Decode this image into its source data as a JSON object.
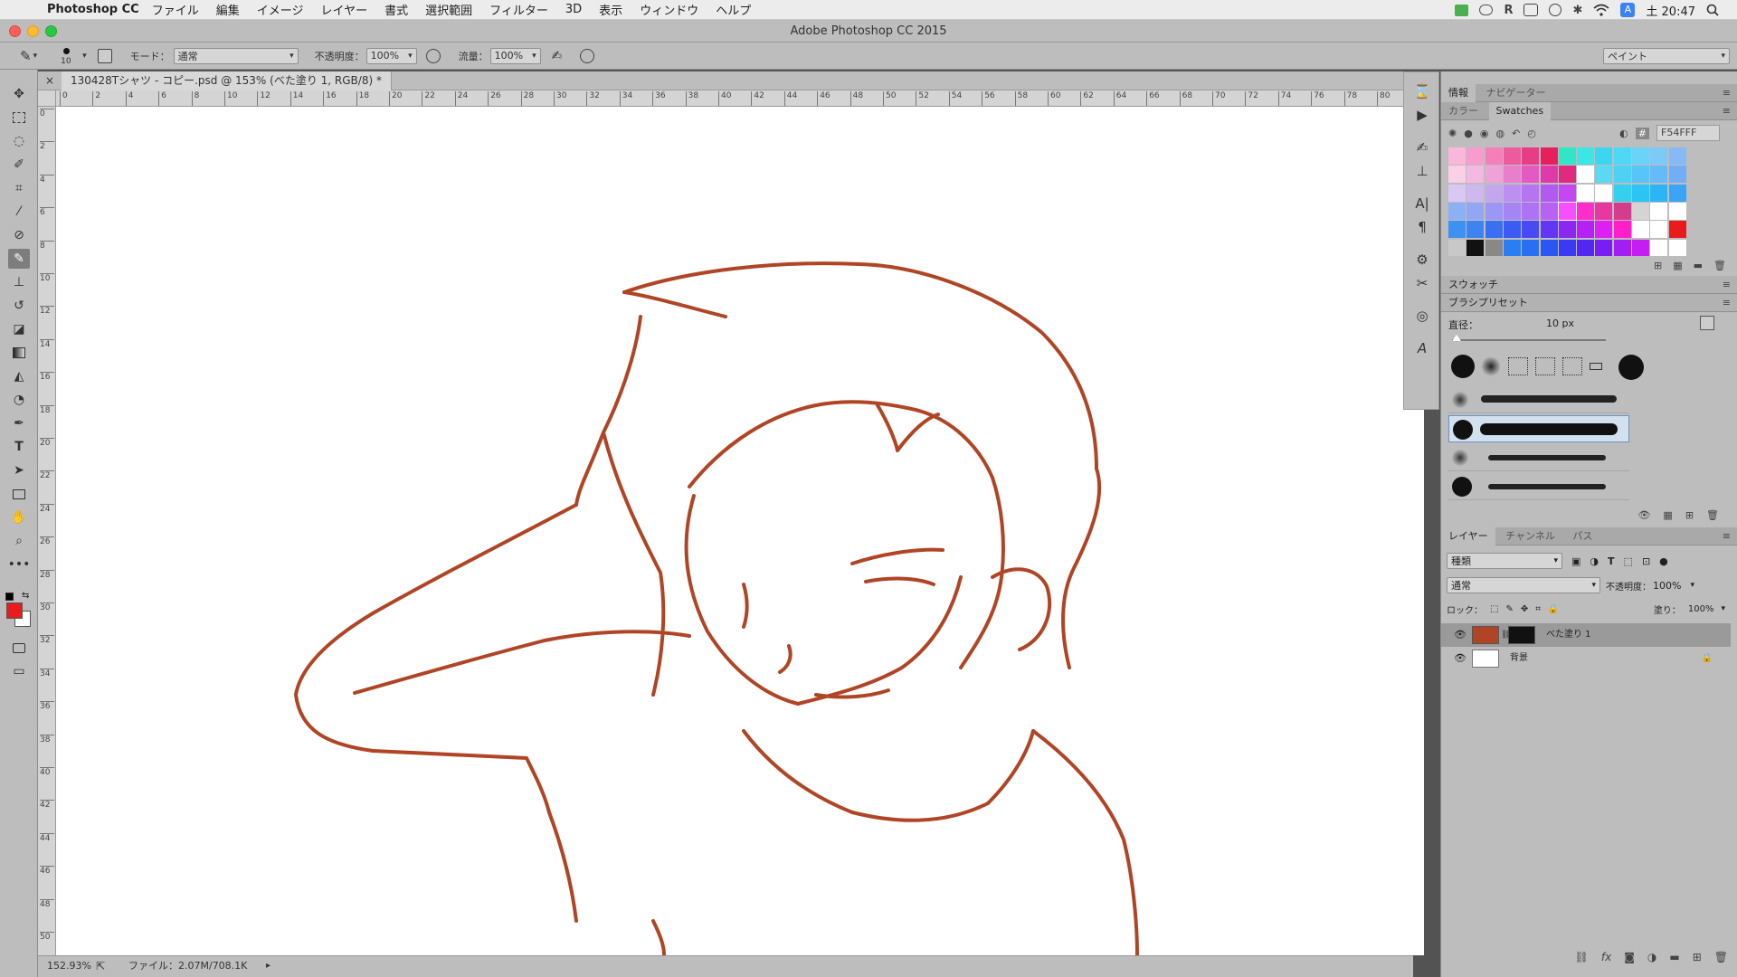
{
  "menubar": {
    "app": "Photoshop CC",
    "items": [
      "ファイル",
      "編集",
      "イメージ",
      "レイヤー",
      "書式",
      "選択範囲",
      "フィルター",
      "3D",
      "表示",
      "ウィンドウ",
      "ヘルプ"
    ],
    "clock": "土 20:47",
    "input_indicator": "A"
  },
  "window": {
    "title": "Adobe Photoshop CC 2015"
  },
  "options": {
    "brush_size": "10",
    "mode_label": "モード：",
    "mode_value": "通常",
    "opacity_label": "不透明度：",
    "opacity_value": "100%",
    "flow_label": "流量：",
    "flow_value": "100%",
    "workspace": "ペイント"
  },
  "document": {
    "tab_title": "130428Tシャツ - コピー.psd @ 153% (べた塗り 1, RGB/8) *",
    "zoom": "152.93%",
    "file_info": "ファイル：2.07M/708.1K",
    "ruler_labels": [
      "0",
      "2",
      "4",
      "6",
      "8",
      "10",
      "12",
      "14",
      "16",
      "18",
      "20",
      "22",
      "24",
      "26",
      "28",
      "30",
      "32",
      "34",
      "36",
      "38",
      "40",
      "42",
      "44",
      "46",
      "48",
      "50",
      "52",
      "54",
      "56",
      "58",
      "60",
      "62",
      "64",
      "66",
      "68",
      "70",
      "72",
      "74",
      "76",
      "78",
      "80"
    ],
    "vruler_labels": [
      "0",
      "2",
      "4",
      "6",
      "8",
      "10",
      "12",
      "14",
      "16",
      "18",
      "20",
      "22",
      "24",
      "26",
      "28",
      "30",
      "32",
      "34",
      "36",
      "38",
      "40",
      "42",
      "44",
      "46",
      "48",
      "50"
    ]
  },
  "colors": {
    "foreground": "#e81c1c",
    "background": "#ffffff",
    "line_art": "#b04525",
    "selected_swatch": "#f54fff"
  },
  "color_panel": {
    "tabs": [
      "情報",
      "ナビゲーター"
    ],
    "tabs2": [
      "カラー",
      "Swatches"
    ],
    "hex": "F54FFF"
  },
  "swatches_label": "スウォッチ",
  "brush_presets": {
    "title": "ブラシプリセット",
    "size_label": "直径：",
    "size_value": "10 px"
  },
  "layers": {
    "tabs": [
      "レイヤー",
      "チャンネル",
      "パス"
    ],
    "filter": "種類",
    "blend": "通常",
    "opacity_label": "不透明度：",
    "opacity_value": "100%",
    "lock_label": "ロック：",
    "fill_label": "塗り：",
    "fill_value": "100%",
    "items": [
      {
        "name": "べた塗り 1",
        "selected": true
      },
      {
        "name": "背景",
        "selected": false
      }
    ]
  }
}
